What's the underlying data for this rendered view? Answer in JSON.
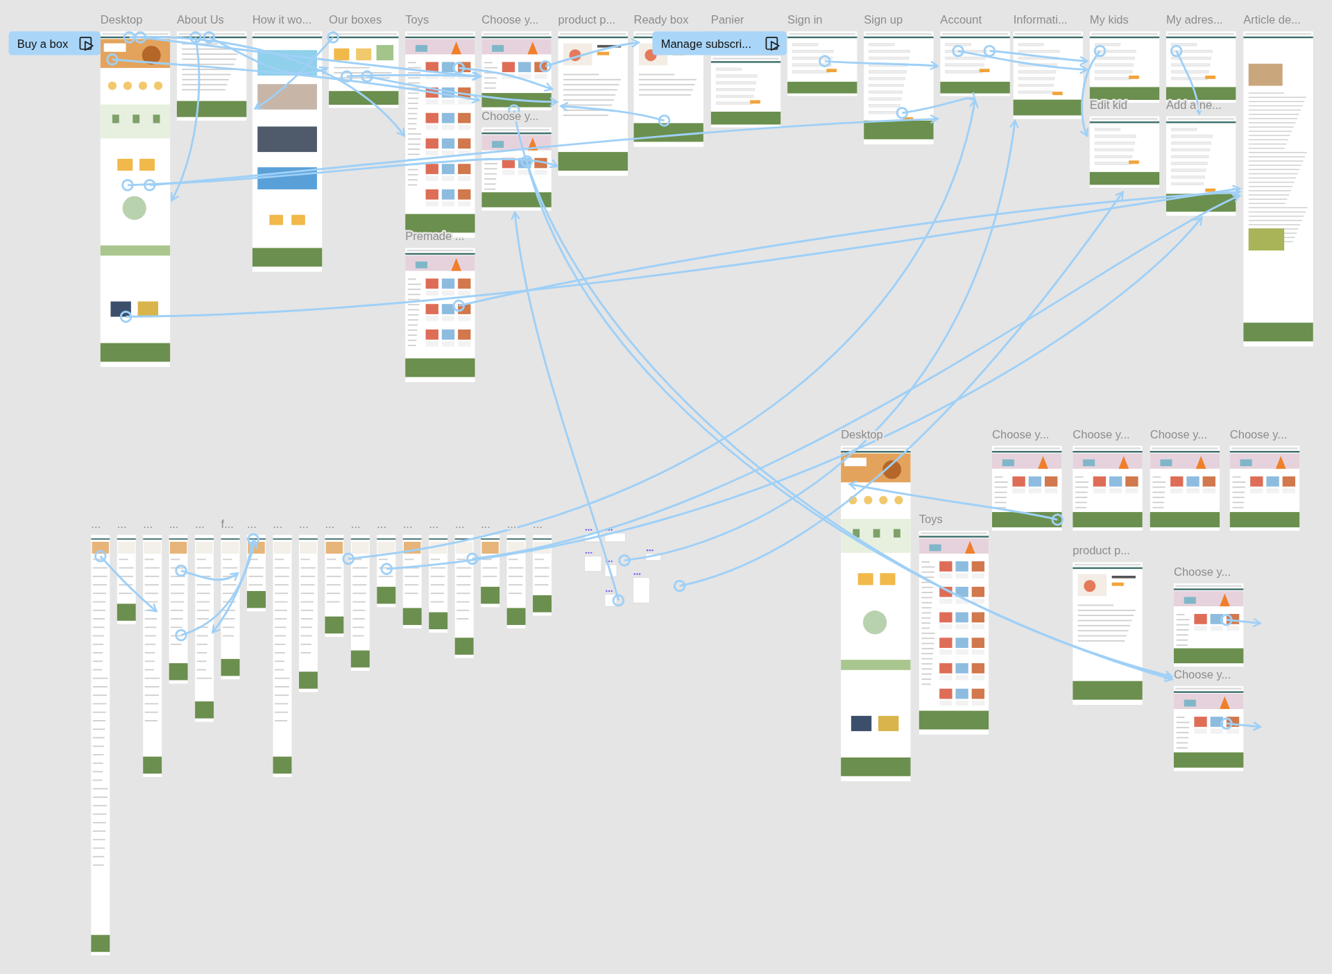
{
  "canvas": {
    "flow_starts": [
      {
        "label": "Buy a box"
      },
      {
        "label": "Manage subscri..."
      }
    ],
    "frames": [
      {
        "label": "Desktop",
        "kind": "home"
      },
      {
        "label": "About Us",
        "kind": "text"
      },
      {
        "label": "How it wo...",
        "kind": "steps"
      },
      {
        "label": "Our boxes",
        "kind": "boxes"
      },
      {
        "label": "Toys",
        "kind": "catalog"
      },
      {
        "label": "Choose y...",
        "kind": "catalog"
      },
      {
        "label": "product p...",
        "kind": "product"
      },
      {
        "label": "Ready box",
        "kind": "product"
      },
      {
        "label": "Panier",
        "kind": "form"
      },
      {
        "label": "Sign in",
        "kind": "form"
      },
      {
        "label": "Sign up",
        "kind": "form"
      },
      {
        "label": "Account",
        "kind": "form"
      },
      {
        "label": "Informati...",
        "kind": "form"
      },
      {
        "label": "My kids",
        "kind": "form"
      },
      {
        "label": "My adres...",
        "kind": "form"
      },
      {
        "label": "Article de...",
        "kind": "article"
      },
      {
        "label": "Premade ...",
        "kind": "catalog"
      },
      {
        "label": "Choose y...",
        "kind": "catalog"
      },
      {
        "label": "Edit kid",
        "kind": "form"
      },
      {
        "label": "Add a ne...",
        "kind": "form"
      },
      {
        "label": "Desktop",
        "kind": "home"
      },
      {
        "label": "Toys",
        "kind": "catalog"
      },
      {
        "label": "Choose y...",
        "kind": "catalog"
      },
      {
        "label": "Choose y...",
        "kind": "catalog"
      },
      {
        "label": "Choose y...",
        "kind": "catalog"
      },
      {
        "label": "Choose y...",
        "kind": "catalog"
      },
      {
        "label": "product p...",
        "kind": "product"
      },
      {
        "label": "Choose y...",
        "kind": "catalog"
      },
      {
        "label": "Choose y...",
        "kind": "catalog"
      }
    ],
    "mobile_frames": [
      {
        "label": "..."
      },
      {
        "label": "..."
      },
      {
        "label": "..."
      },
      {
        "label": "..."
      },
      {
        "label": "..."
      },
      {
        "label": "f..."
      },
      {
        "label": "..."
      },
      {
        "label": "..."
      },
      {
        "label": "..."
      },
      {
        "label": "..."
      },
      {
        "label": "..."
      },
      {
        "label": "..."
      },
      {
        "label": "..."
      },
      {
        "label": "..."
      },
      {
        "label": "..."
      },
      {
        "label": "..."
      },
      {
        "label": "..."
      },
      {
        "label": "..."
      }
    ]
  }
}
